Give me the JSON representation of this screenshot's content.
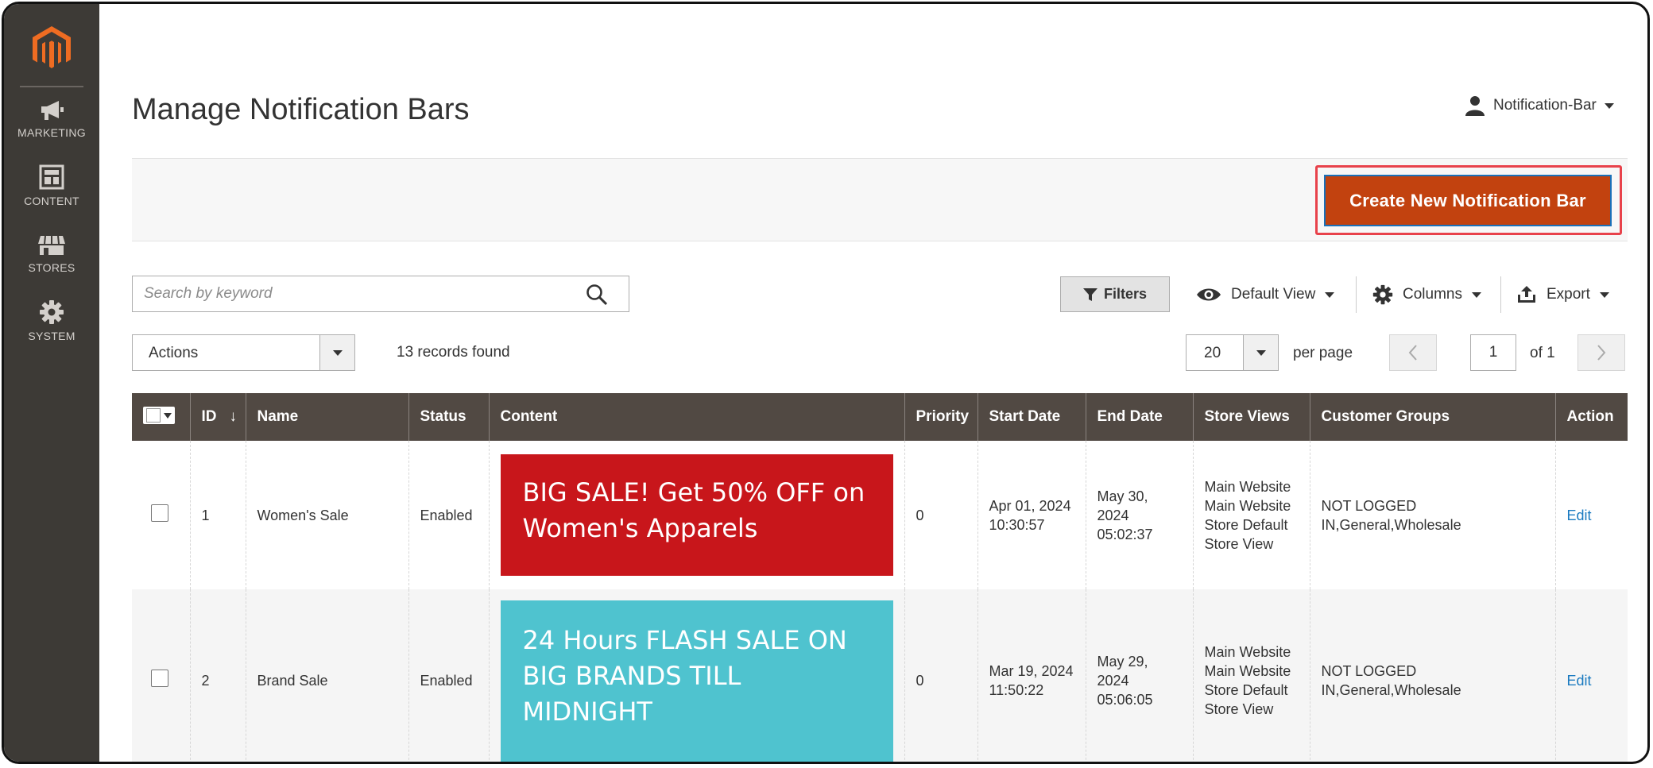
{
  "sidebar": {
    "logo": "magento-logo",
    "items": [
      {
        "label": "MARKETING",
        "icon": "megaphone-icon"
      },
      {
        "label": "CONTENT",
        "icon": "layout-icon"
      },
      {
        "label": "STORES",
        "icon": "store-icon"
      },
      {
        "label": "SYSTEM",
        "icon": "gear-icon"
      }
    ]
  },
  "header": {
    "title": "Manage Notification Bars",
    "user": "Notification-Bar"
  },
  "action_bar": {
    "create_label": "Create New Notification Bar"
  },
  "toolbar": {
    "search_placeholder": "Search by keyword",
    "filters_label": "Filters",
    "view_label": "Default View",
    "columns_label": "Columns",
    "export_label": "Export",
    "actions_label": "Actions",
    "records_found": "13 records found",
    "per_page_value": "20",
    "per_page_label": "per page",
    "current_page": "1",
    "page_of": "of 1"
  },
  "table": {
    "columns": [
      "ID",
      "Name",
      "Status",
      "Content",
      "Priority",
      "Start Date",
      "End Date",
      "Store Views",
      "Customer Groups",
      "Action"
    ],
    "rows": [
      {
        "id": "1",
        "name": "Women's Sale",
        "status": "Enabled",
        "content": "BIG SALE! Get 50% OFF on Women's Apparels",
        "content_color": "#c8161b",
        "priority": "0",
        "start_date": "Apr 01, 2024 10:30:57",
        "end_date": "May 30, 2024 05:02:37",
        "store_views": "Main Website Main Website Store Default Store View",
        "customer_groups": "NOT LOGGED IN,General,Wholesale",
        "action": "Edit"
      },
      {
        "id": "2",
        "name": "Brand Sale",
        "status": "Enabled",
        "content": "24 Hours FLASH SALE ON BIG BRANDS TILL MIDNIGHT",
        "content_color": "#4fc3cf",
        "priority": "0",
        "start_date": "Mar 19, 2024 11:50:22",
        "end_date": "May 29, 2024 05:06:05",
        "store_views": "Main Website Main Website Store Default Store View",
        "customer_groups": "NOT LOGGED IN,General,Wholesale",
        "action": "Edit"
      }
    ]
  },
  "colors": {
    "sidebar_bg": "#3d3a36",
    "table_header_bg": "#514943",
    "primary_button": "#c2420f",
    "highlight_border": "#e8424b",
    "link": "#1a7ac0"
  }
}
